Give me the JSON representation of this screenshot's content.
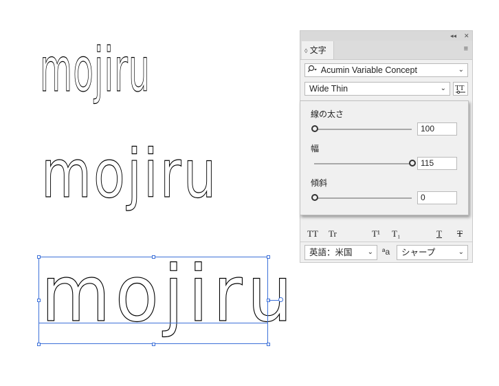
{
  "samples": [
    "mojiru",
    "mojiru",
    "mojiru"
  ],
  "panel": {
    "collapse_glyph": "◂◂",
    "close_glyph": "✕",
    "tab_label": "文字",
    "tab_arrow": "◊",
    "menu_glyph": "≡",
    "font_family": "Acumin Variable Concept",
    "font_style": "Wide Thin",
    "search_icon": "search-icon",
    "variable_font_icon": "variable-font-icon",
    "axes": [
      {
        "label": "線の太さ",
        "value": "100",
        "fraction": 0.0
      },
      {
        "label": "幅",
        "value": "115",
        "fraction": 1.0
      },
      {
        "label": "傾斜",
        "value": "0",
        "fraction": 0.0
      }
    ],
    "type_buttons": [
      "TT",
      "Tr",
      "T¹",
      "T₁",
      "T",
      "T"
    ],
    "language": "英語：米国",
    "aa_glyph": "ªa",
    "antialias": "シャープ"
  },
  "colors": {
    "selection": "#3b6fd8"
  }
}
